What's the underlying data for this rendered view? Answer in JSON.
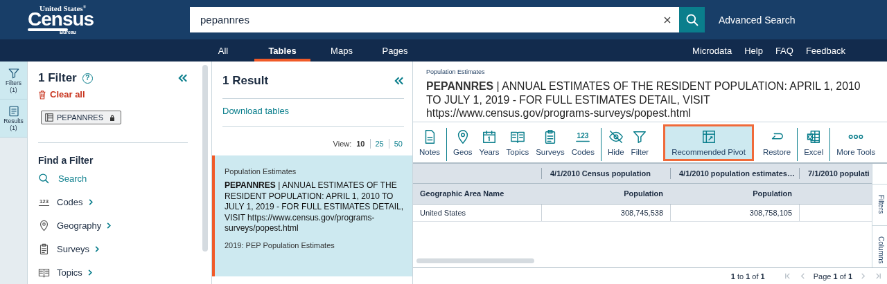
{
  "header": {
    "logo": {
      "top": "United States",
      "mark": "®",
      "main": "Census",
      "bottom": "Bureau"
    },
    "search": {
      "value": "pepannres"
    },
    "advanced_search": "Advanced Search"
  },
  "nav": {
    "tabs": [
      {
        "label": "All",
        "selected": false
      },
      {
        "label": "Tables",
        "selected": true
      },
      {
        "label": "Maps",
        "selected": false
      },
      {
        "label": "Pages",
        "selected": false
      }
    ],
    "links": [
      "Microdata",
      "Help",
      "FAQ",
      "Feedback"
    ]
  },
  "rail": [
    {
      "kind": "filter",
      "label": "Filters",
      "count": "(1)",
      "selected": true
    },
    {
      "kind": "results",
      "label": "Results",
      "count": "(1)",
      "selected": true
    }
  ],
  "filter_panel": {
    "title": "1 Filter",
    "help": "?",
    "clear_all": "Clear all",
    "chips": [
      {
        "label": "PEPANNRES",
        "locked": true
      }
    ],
    "find_title": "Find a Filter",
    "search_link": "Search",
    "items": [
      {
        "kind": "codes",
        "icon_text": "123",
        "label": "Codes"
      },
      {
        "kind": "pin",
        "label": "Geography"
      },
      {
        "kind": "clipboard",
        "label": "Surveys"
      },
      {
        "kind": "book",
        "label": "Topics"
      }
    ]
  },
  "results_panel": {
    "title": "1 Result",
    "download": "Download tables",
    "view_label": "View:",
    "view_options": [
      {
        "label": "10",
        "selected": true
      },
      {
        "label": "25",
        "selected": false
      },
      {
        "label": "50",
        "selected": false
      }
    ],
    "results": [
      {
        "category": "Population Estimates",
        "title": "**PEPANNRES** | ANNUAL ESTIMATES OF THE RESIDENT POPULATION: APRIL 1, 2010 TO JULY 1, 2019 - FOR FULL ESTIMATES DETAIL, VISIT https://www.census.gov/programs-surveys/popest.html",
        "vintage": "2019: PEP Population Estimates",
        "selected": true
      }
    ]
  },
  "table_view": {
    "category": "Population Estimates",
    "title": "**PEPANNRES** | ANNUAL ESTIMATES OF THE RESIDENT POPULATION: APRIL 1, 2010 TO JULY 1, 2019 - FOR FULL ESTIMATES DETAIL, VISIT https://www.census.gov/programs-surveys/popest.html",
    "tool_groups": [
      [
        {
          "kind": "notes",
          "label": "Notes",
          "highlighted": false
        }
      ],
      [
        {
          "kind": "pin",
          "label": "Geos",
          "highlighted": false
        },
        {
          "kind": "calendar",
          "label": "Years",
          "highlighted": false
        },
        {
          "kind": "book",
          "label": "Topics",
          "highlighted": false
        },
        {
          "kind": "clipboard",
          "label": "Surveys",
          "highlighted": false
        },
        {
          "kind": "codes",
          "icon_text": "123",
          "label": "Codes",
          "highlighted": false
        }
      ],
      [
        {
          "kind": "eye-off",
          "label": "Hide",
          "highlighted": false
        },
        {
          "kind": "filter",
          "label": "Filter",
          "highlighted": false
        },
        {
          "kind": "pivot",
          "label": "Recommended Pivot",
          "highlighted": true
        },
        {
          "kind": "restore",
          "label": "Restore",
          "highlighted": false
        }
      ],
      [
        {
          "kind": "excel",
          "label": "Excel",
          "highlighted": false
        }
      ],
      [
        {
          "kind": "dots",
          "label": "More Tools",
          "highlighted": false
        }
      ]
    ],
    "table": {
      "column_groups": [
        "4/1/2010 Census population",
        "4/1/2010 population estimates…",
        "7/1/2010 populati"
      ],
      "columns": [
        "Geographic Area Name",
        "Population",
        "Population"
      ],
      "rows": [
        [
          "United States",
          "308,745,538",
          "308,758,105"
        ]
      ]
    },
    "side_tabs": [
      "Filters",
      "Columns"
    ],
    "row_count": "**1** to **1** of **1**",
    "page": "Page **1** of **1**"
  }
}
